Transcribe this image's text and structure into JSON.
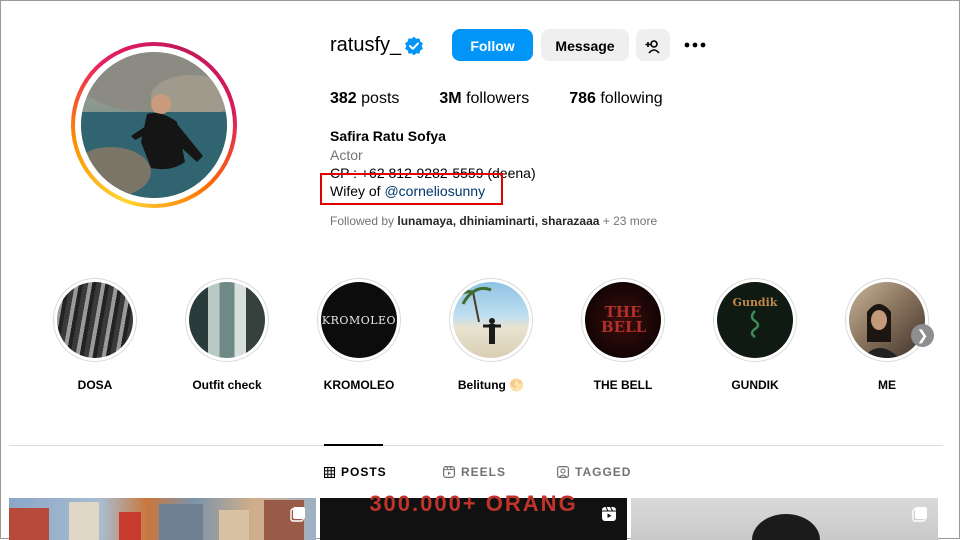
{
  "profile": {
    "username": "ratusfy_",
    "verified_icon": "verified-badge-icon",
    "follow_label": "Follow",
    "message_label": "Message",
    "add_user_icon": "add-user-icon",
    "more_icon": "more-horizontal-icon"
  },
  "stats": {
    "posts_count": "382",
    "posts_label": " posts",
    "followers_count": "3M",
    "followers_label": " followers",
    "following_count": "786",
    "following_label": " following"
  },
  "bio": {
    "name": "Safira Ratu Sofya",
    "category": "Actor",
    "contact": "CP : +62 812-9282-5559 (deena)",
    "wifey_prefix": "Wifey of ",
    "wifey_mention": "@corneliosunny",
    "followed_by_prefix": "Followed by ",
    "followed_by_users": "lunamaya, dhiniaminarti, sharazaaa",
    "followed_by_more": " + 23 more"
  },
  "highlights": [
    {
      "label": "DOSA"
    },
    {
      "label": "Outfit check"
    },
    {
      "label": "KROMOLEO",
      "cover_text": "KROMOLEO"
    },
    {
      "label": "Belitung 🌕"
    },
    {
      "label": "THE BELL",
      "cover_text": "THE BELL"
    },
    {
      "label": "GUNDIK",
      "cover_text": "Gundik"
    },
    {
      "label": "ME"
    }
  ],
  "tabs": {
    "posts": "POSTS",
    "reels": "REELS",
    "tagged": "TAGGED"
  },
  "grid": {
    "tile2_text": "300.000+ ORANG"
  },
  "colors": {
    "follow_blue": "#0095f6",
    "highlight_red": "#e00000",
    "link_blue": "#00376b"
  }
}
